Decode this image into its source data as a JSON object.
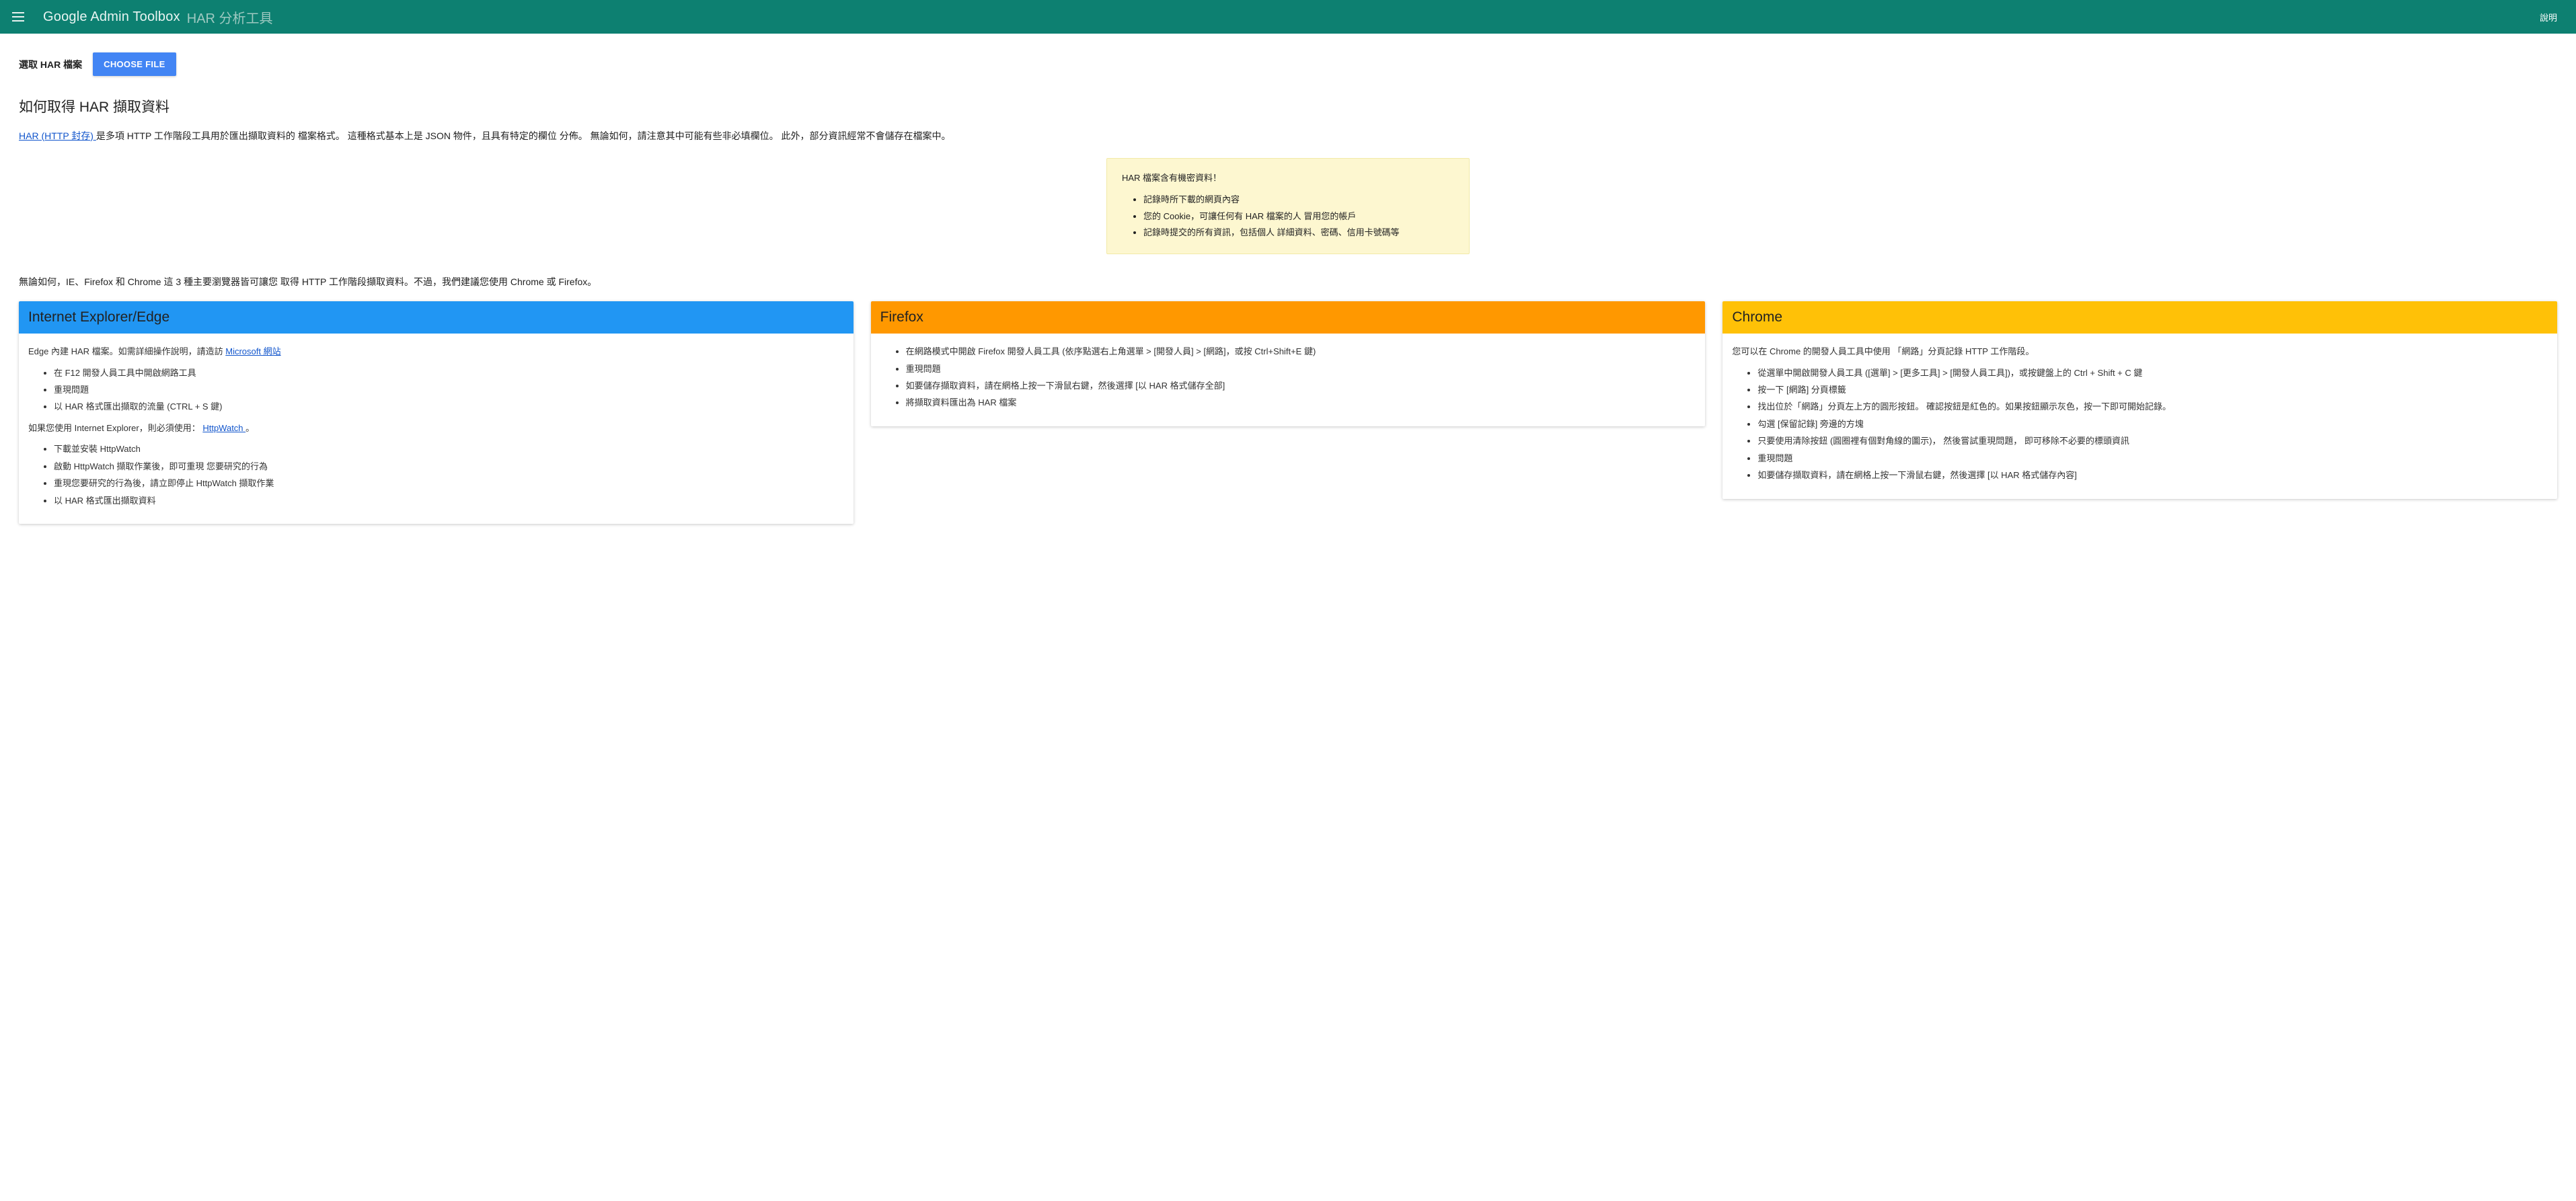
{
  "header": {
    "brand_main": "Google Admin Toolbox",
    "brand_sub": "HAR 分析工具",
    "help": "說明"
  },
  "file": {
    "label": "選取 HAR 檔案",
    "button": "CHOOSE FILE"
  },
  "section_title": "如何取得 HAR 擷取資料",
  "intro": {
    "link_text": "HAR (HTTP 封存) ",
    "rest": "是多項 HTTP 工作階段工具用於匯出擷取資料的 檔案格式。 這種格式基本上是 JSON 物件，且具有特定的欄位 分佈。 無論如何，請注意其中可能有些非必填欄位。 此外，部分資訊經常不會儲存在檔案中。"
  },
  "warning": {
    "title": "HAR 檔案含有機密資料！",
    "items": [
      "記錄時所下載的網頁內容",
      "您的 Cookie，可讓任何有 HAR 檔案的人 冒用您的帳戶",
      "記錄時提交的所有資訊，包括個人 詳細資料、密碼、信用卡號碼等"
    ]
  },
  "browsers_intro": "無論如何，IE、Firefox 和 Chrome 這 3 種主要瀏覽器皆可讓您 取得 HTTP 工作階段擷取資料。不過，我們建議您使用 Chrome 或 Firefox。",
  "cards": [
    {
      "key": "ie",
      "title": "Internet Explorer/Edge",
      "p1_a": "Edge 內建 HAR 檔案。如需詳細操作說明，請造訪 ",
      "p1_link": "Microsoft 網站",
      "list1": [
        "在 F12 開發人員工具中開啟網路工具",
        "重現問題",
        "以 HAR 格式匯出擷取的流量 (CTRL + S 鍵)"
      ],
      "p2_a": "如果您使用 Internet Explorer，則必須使用： ",
      "p2_link": "HttpWatch ",
      "p2_b": "。",
      "list2": [
        "下載並安裝 HttpWatch",
        "啟動 HttpWatch 擷取作業後，即可重現 您要研究的行為",
        "重現您要研究的行為後，請立即停止 HttpWatch 擷取作業",
        "以 HAR 格式匯出擷取資料"
      ]
    },
    {
      "key": "ff",
      "title": "Firefox",
      "list1": [
        "在網路模式中開啟 Firefox 開發人員工具 (依序點選右上角選單 > [開發人員] > [網路]，或按 Ctrl+Shift+E 鍵)",
        "重現問題",
        "如要儲存擷取資料，請在網格上按一下滑鼠右鍵，然後選擇 [以 HAR 格式儲存全部]",
        "將擷取資料匯出為 HAR 檔案"
      ]
    },
    {
      "key": "ch",
      "title": "Chrome",
      "p1": "您可以在 Chrome 的開發人員工具中使用 「網路」分頁記錄 HTTP 工作階段。",
      "list1": [
        "從選單中開啟開發人員工具 ([選單] > [更多工具] > [開發人員工具])，或按鍵盤上的 Ctrl + Shift + C 鍵",
        "按一下 [網路] 分頁標籤",
        "找出位於「網路」分頁左上方的圓形按鈕。 確認按鈕是紅色的。如果按鈕顯示灰色，按一下即可開始記錄。",
        "勾選 [保留記錄] 旁邊的方塊",
        "只要使用清除按鈕 (圓圈裡有個對角線的圖示)， 然後嘗試重現問題， 即可移除不必要的標頭資訊",
        "重現問題",
        "如要儲存擷取資料，請在網格上按一下滑鼠右鍵，然後選擇 [以 HAR 格式儲存內容]"
      ]
    }
  ]
}
